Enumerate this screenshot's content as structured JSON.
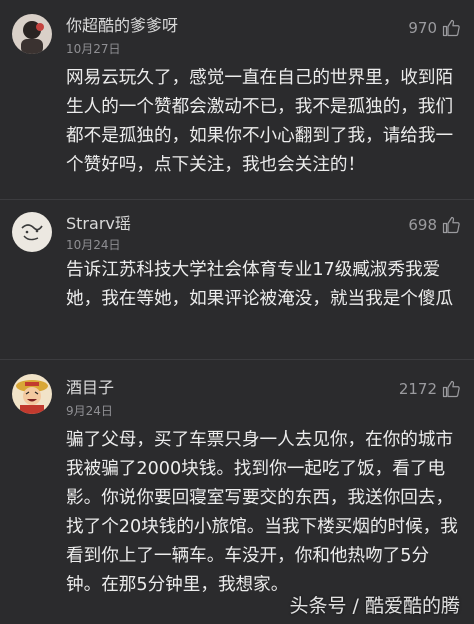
{
  "comments": [
    {
      "username": "你超酷的爹爹呀",
      "date": "10月27日",
      "likes": "970",
      "text": "网易云玩久了，感觉一直在自己的世界里，收到陌生人的一个赞都会激动不已，我不是孤独的，我们都不是孤独的，如果你不小心翻到了我，请给我一个赞好吗，点下关注，我也会关注的！"
    },
    {
      "username": "Strarv瑶",
      "date": "10月24日",
      "likes": "698",
      "text": "告诉江苏科技大学社会体育专业17级臧淑秀我爱她，我在等她，如果评论被淹没，就当我是个傻瓜"
    },
    {
      "username": "酒目子",
      "date": "9月24日",
      "likes": "2172",
      "text": "骗了父母，买了车票只身一人去见你，在你的城市我被骗了2000块钱。找到你一起吃了饭，看了电影。你说你要回寝室写要交的东西，我送你回去，找了个20块钱的小旅馆。当我下楼买烟的时候，我看到你上了一辆车。车没开，你和他热吻了5分钟。在那5分钟里，我想家。"
    }
  ],
  "icons": {
    "like": "thumbs-up-icon"
  },
  "watermark": "头条号 / 酷爱酷的腾"
}
